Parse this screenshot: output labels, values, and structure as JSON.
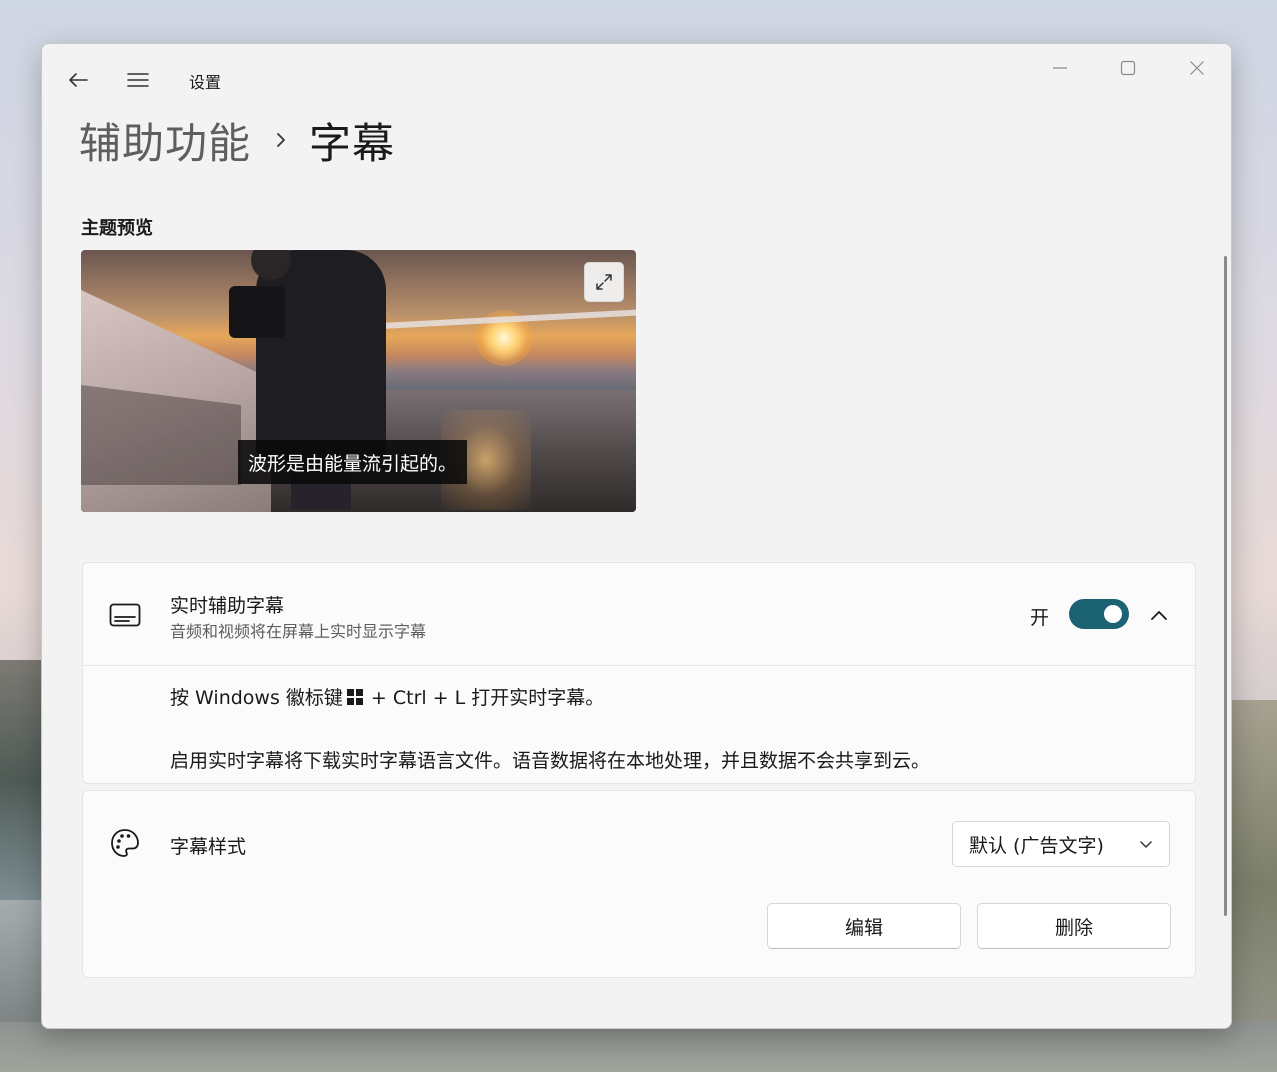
{
  "window": {
    "app_title": "设置",
    "controls": {
      "minimize": "minimize-icon",
      "maximize": "maximize-icon",
      "close": "close-icon"
    }
  },
  "breadcrumb": {
    "parent": "辅助功能",
    "current": "字幕"
  },
  "theme_preview": {
    "label": "主题预览",
    "caption_text": "波形是由能量流引起的。",
    "expand_icon": "expand-icon"
  },
  "live_captions": {
    "title": "实时辅助字幕",
    "description": "音频和视频将在屏幕上实时显示字幕",
    "toggle_state_label": "开",
    "toggle_on": true,
    "accent_color": "#1b6272",
    "shortcut_prefix": "按 Windows 徽标键",
    "shortcut_suffix": "+ Ctrl + L 打开实时字幕。",
    "info_text": "启用实时字幕将下载实时字幕语言文件。语音数据将在本地处理，并且数据不会共享到云。"
  },
  "caption_style": {
    "title": "字幕样式",
    "selected_option": "默认 (广告文字)",
    "edit_label": "编辑",
    "delete_label": "删除"
  }
}
